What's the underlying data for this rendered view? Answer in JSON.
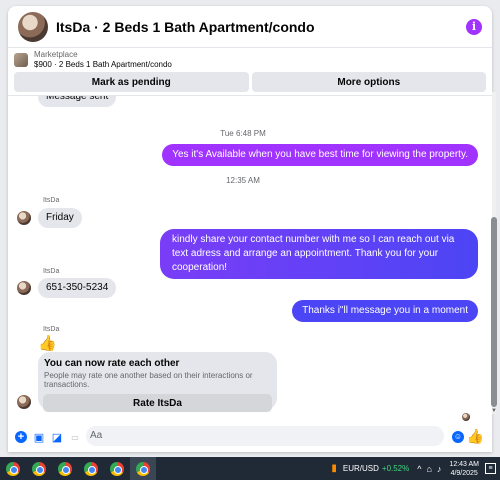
{
  "header": {
    "title": "ItsDa · 2 Beds 1 Bath Apartment/condo",
    "info_icon": "info-icon"
  },
  "marketplace": {
    "label": "Marketplace",
    "listing": "$900 · 2 Beds 1 Bath Apartment/condo"
  },
  "actions": {
    "pending": "Mark as pending",
    "more": "More options"
  },
  "messages": {
    "partial_top": "Message sent",
    "ts1": "Tue 6:48 PM",
    "out1": "Yes it's Available when you have best time for viewing the property.",
    "ts2": "12:35 AM",
    "sender": "ItsDa",
    "in1": "Friday",
    "out2": "kindly share your contact number with me so I can reach out via text adress and arrange an appointment. Thank you for your cooperation!",
    "in2": "651-350-5234",
    "out3": "Thanks i\"ll message you in a moment",
    "thumbs": "👍",
    "rate_title": "You can now rate each other",
    "rate_sub": "People may rate one another based on their interactions or transactions.",
    "rate_button": "Rate ItsDa"
  },
  "composer": {
    "placeholder": "Aa"
  },
  "taskbar": {
    "pair": "EUR/USD",
    "change": "+0.52%",
    "time": "12:43 AM",
    "date": "4/9/2025"
  },
  "colors": {
    "accent": "#0866ff",
    "bubble_purple": "#a033ff",
    "bubble_blue": "#4c45f5"
  }
}
